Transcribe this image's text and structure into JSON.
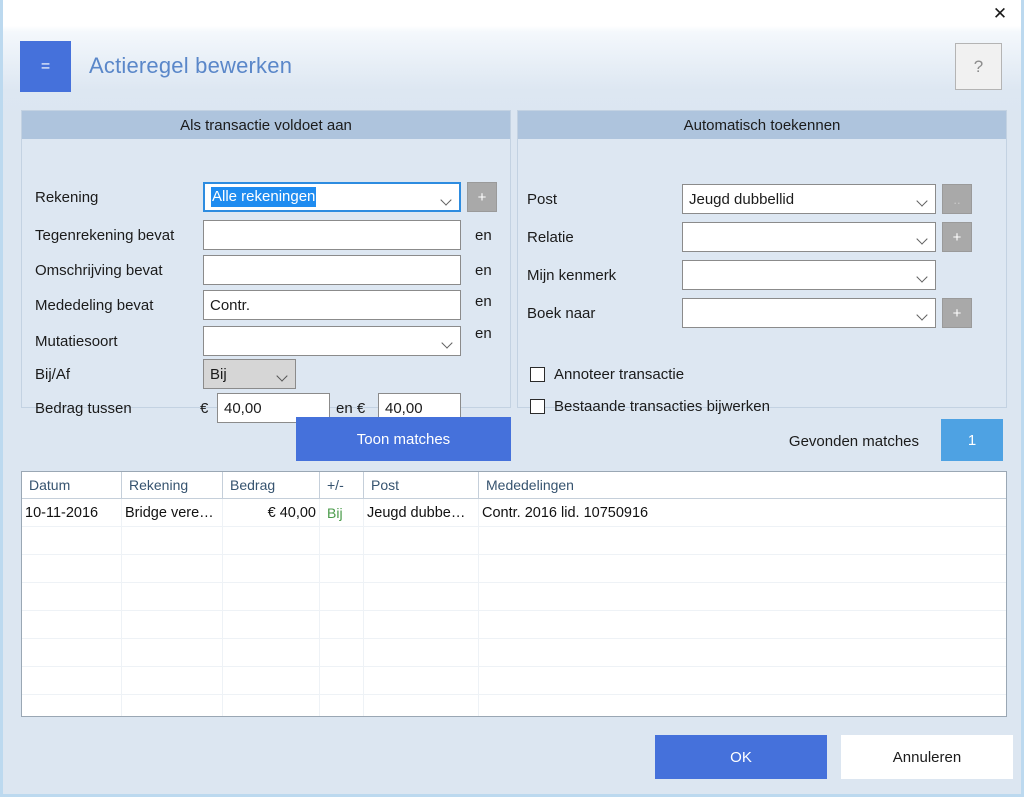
{
  "titlebar": {
    "close_icon": "close-icon",
    "close_glyph": "✕"
  },
  "header": {
    "icon_glyph": "=",
    "title": "Actieregel bewerken",
    "help_glyph": "?"
  },
  "left_panel": {
    "heading": "Als transactie voldoet aan",
    "rows": [
      {
        "label": "Rekening",
        "value": "Alle rekeningen",
        "en": "",
        "button": "+"
      },
      {
        "label": "Tegenrekening bevat",
        "value": "",
        "en": "en",
        "button": ""
      },
      {
        "label": "Omschrijving bevat",
        "value": "",
        "en": "en",
        "button": ""
      },
      {
        "label": "Mededeling bevat",
        "value": "Contr.",
        "en": "en",
        "button": ""
      },
      {
        "label": "Mutatiesoort",
        "value": "",
        "en": "en",
        "button": ""
      }
    ],
    "bijaf": {
      "label": "Bij/Af",
      "value": "Bij"
    },
    "bedrag": {
      "label": "Bedrag tussen",
      "currency_from": "€",
      "from": "40,00",
      "middle": "en €",
      "to": "40,00"
    }
  },
  "right_panel": {
    "heading": "Automatisch toekennen",
    "rows": [
      {
        "label": "Post",
        "value": "Jeugd dubbellid",
        "button": ".."
      },
      {
        "label": "Relatie",
        "value": "",
        "button": "+"
      },
      {
        "label": "Mijn kenmerk",
        "value": "",
        "button": ""
      },
      {
        "label": "Boek naar",
        "value": "",
        "button": "+"
      }
    ],
    "checkboxes": [
      {
        "label": "Annoteer transactie",
        "checked": false
      },
      {
        "label": "Bestaande transacties bijwerken",
        "checked": false
      }
    ]
  },
  "matches": {
    "show_button": "Toon matches",
    "found_label": "Gevonden matches",
    "count": "1"
  },
  "table": {
    "columns": [
      "Datum",
      "Rekening",
      "Bedrag",
      "+/-",
      "Post",
      "Mededelingen"
    ],
    "rows": [
      {
        "datum": "10-11-2016",
        "rekening": "Bridge vere…",
        "bedrag": "€ 40,00",
        "plusmin": "Bij",
        "post": "Jeugd dubbe…",
        "mededelingen": "Contr. 2016 lid. 10750916"
      }
    ],
    "empty_row_count": 7
  },
  "footer": {
    "ok": "OK",
    "cancel": "Annuleren"
  },
  "colors": {
    "accent_blue": "#4571db",
    "badge_blue": "#4ea2e3",
    "panel_head": "#aec4dd",
    "dialog_bg": "#dce6f1",
    "title_text": "#5a87c9",
    "selection_blue": "#1f8cf0",
    "bij_green": "#4a9b4a"
  }
}
